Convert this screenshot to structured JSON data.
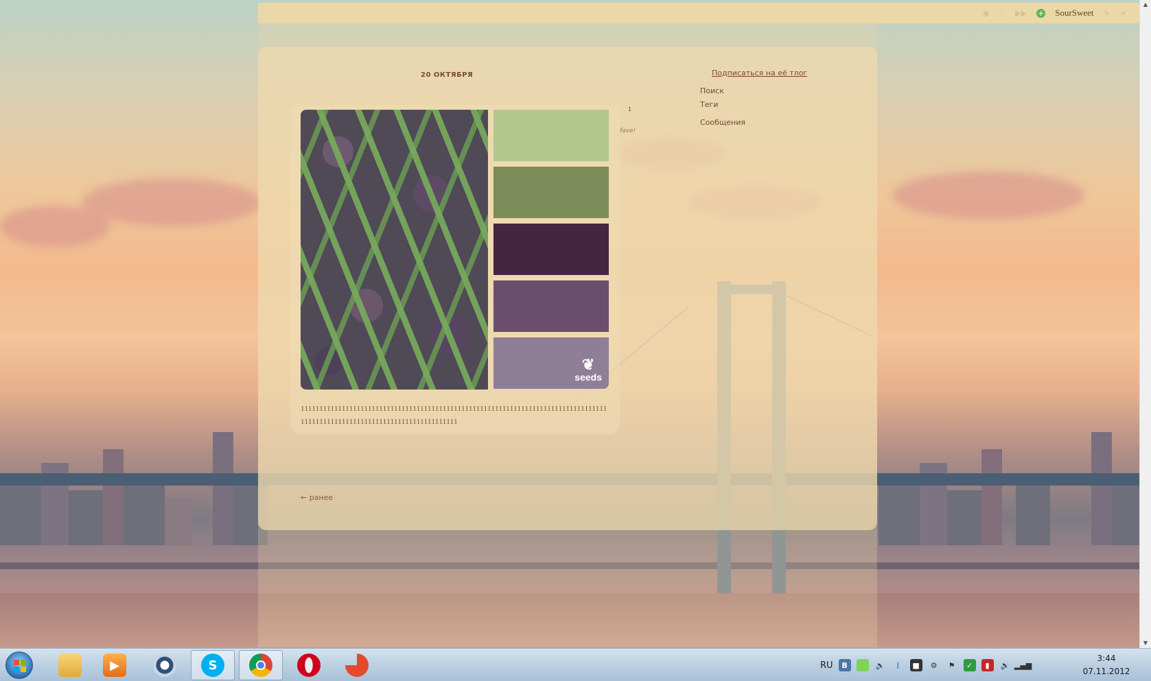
{
  "topbar": {
    "user": "SourSweet",
    "icons": [
      "rss-icon",
      "heart-icon",
      "forward-icon",
      "add-icon",
      "edit-icon",
      "logout-icon"
    ]
  },
  "post": {
    "date": "20 ОКТЯБРЯ",
    "notes_count": "1",
    "fave_label": "fave!",
    "text": "1111111111111111111111111111111111111111111111111111111111111111111111111111111111111111111111111111111111111111111111111111",
    "swatch_colors": [
      "#b2c78c",
      "#7b8c58",
      "#46263f",
      "#6b4e6e",
      "#8f7f96"
    ],
    "logo_text": "seeds"
  },
  "sidebar": {
    "subscribe": "Подписаться на её тлог",
    "links": [
      "Поиск",
      "Теги",
      "Сообщения"
    ]
  },
  "nav": {
    "prev": "← ранее"
  },
  "taskbar": {
    "apps": [
      "explorer",
      "media-player",
      "webcam",
      "skype",
      "chrome",
      "opera",
      "photoscape"
    ],
    "language": "RU",
    "time": "3:44",
    "date": "07.11.2012"
  }
}
